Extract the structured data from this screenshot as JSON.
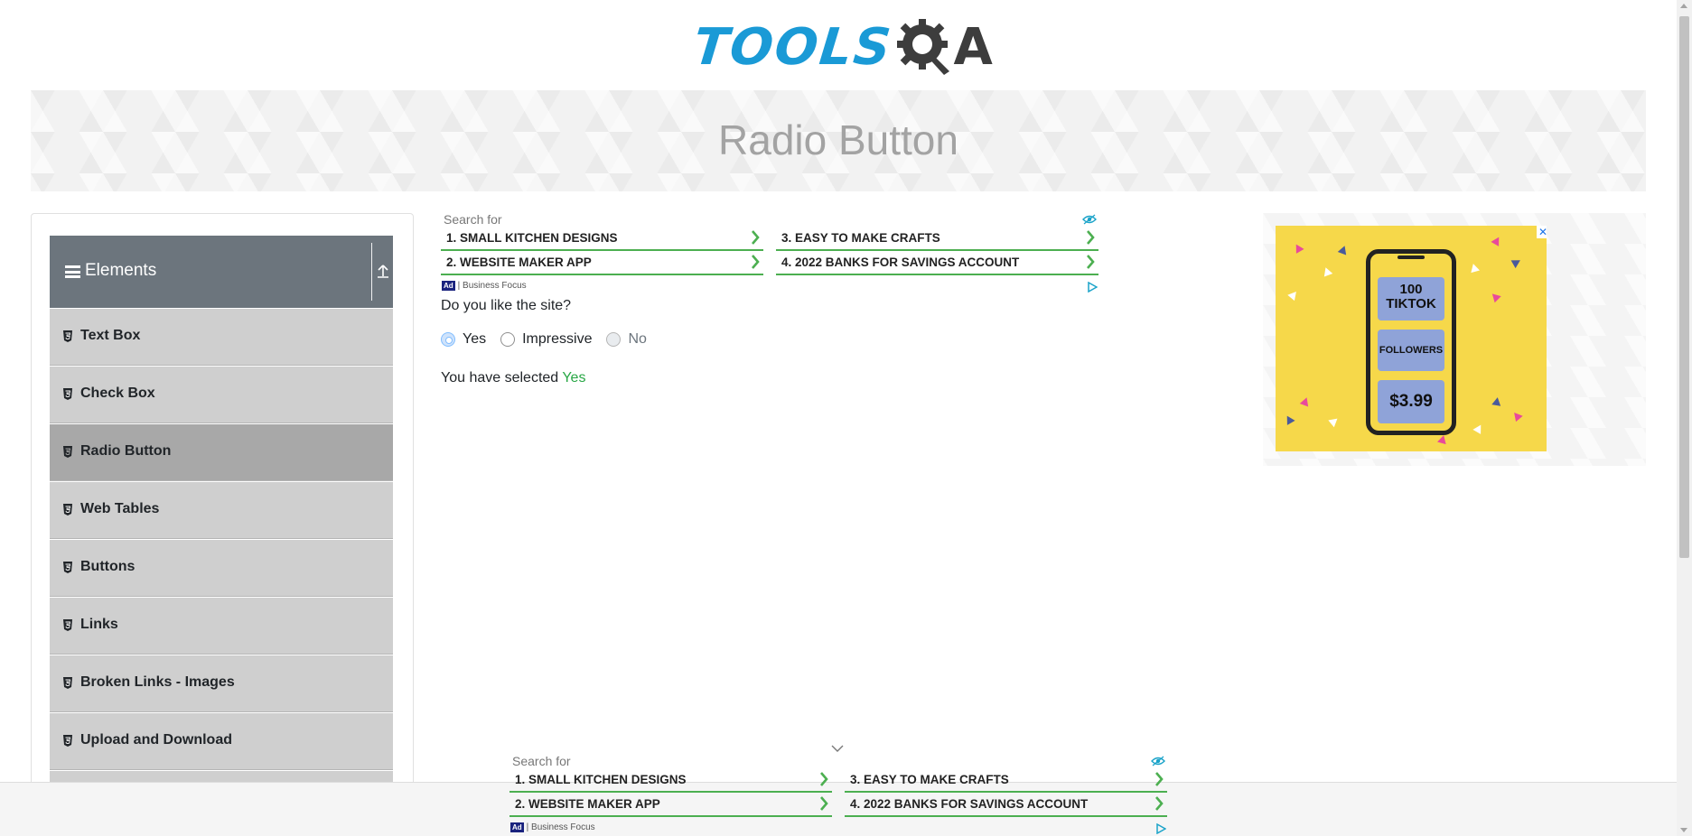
{
  "header": {
    "logo_text_left": "TOOLS",
    "logo_text_right": "A",
    "logo_alt": "ToolsQA"
  },
  "banner": {
    "title": "Radio Button"
  },
  "sidebar": {
    "group": {
      "label": "Elements",
      "icon": "hamburger-icon",
      "collapse_icon": "collapse-up-icon"
    },
    "items": [
      {
        "label": "Text Box",
        "active": false
      },
      {
        "label": "Check Box",
        "active": false
      },
      {
        "label": "Radio Button",
        "active": true
      },
      {
        "label": "Web Tables",
        "active": false
      },
      {
        "label": "Buttons",
        "active": false
      },
      {
        "label": "Links",
        "active": false
      },
      {
        "label": "Broken Links - Images",
        "active": false
      },
      {
        "label": "Upload and Download",
        "active": false
      }
    ]
  },
  "top_ad": {
    "search_for": "Search for",
    "links": [
      "1. SMALL KITCHEN DESIGNS",
      "2. WEBSITE MAKER APP",
      "3. EASY TO MAKE CRAFTS",
      "4. 2022 BANKS FOR SAVINGS ACCOUNT"
    ],
    "ad_mark": "Ad",
    "sponsor": "| Business Focus"
  },
  "main": {
    "question": "Do you like the site?",
    "options": [
      {
        "label": "Yes",
        "checked": true,
        "disabled": false
      },
      {
        "label": "Impressive",
        "checked": false,
        "disabled": false
      },
      {
        "label": "No",
        "checked": false,
        "disabled": true
      }
    ],
    "result_prefix": "You have selected ",
    "result_value": "Yes"
  },
  "right_ad": {
    "close": "✕",
    "card1": "100 TIKTOK",
    "card2": "FOLLOWERS",
    "card3": "$3.99",
    "bg_color": "#f6d84a",
    "card_color": "#8fa3d8"
  },
  "bottom_ad": {
    "search_for": "Search for",
    "links": [
      "1. SMALL KITCHEN DESIGNS",
      "2. WEBSITE MAKER APP",
      "3. EASY TO MAKE CRAFTS",
      "4. 2022 BANKS FOR SAVINGS ACCOUNT"
    ],
    "ad_mark": "Ad",
    "sponsor": "| Business Focus"
  },
  "colors": {
    "sidebar_header": "#6c757d",
    "menu_item": "#cfcfcf",
    "menu_active": "#a8a8a8",
    "logo_blue": "#1a9ad6",
    "success": "#28a745",
    "ad_underline": "#4caf50"
  }
}
